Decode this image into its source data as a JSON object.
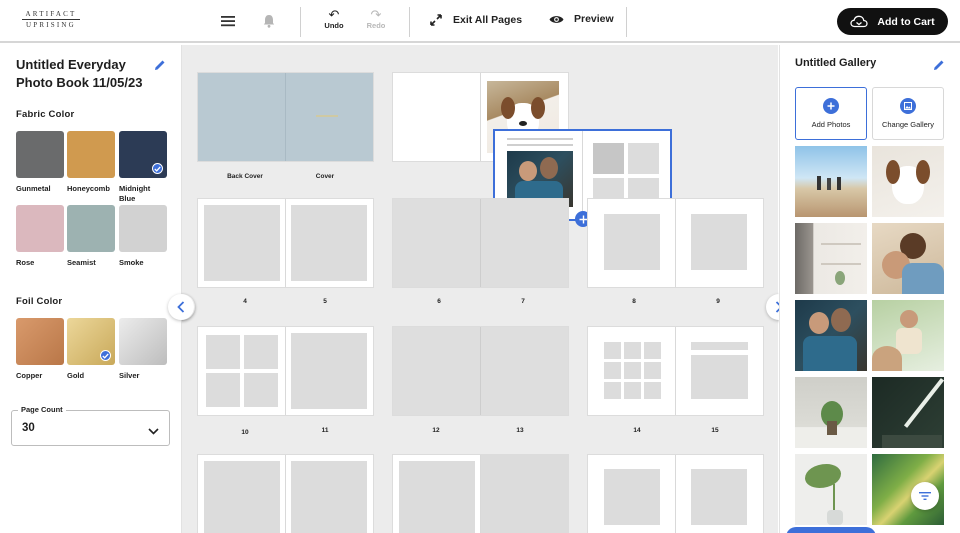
{
  "brand": {
    "line1": "ARTIFACT",
    "line2": "UPRISING"
  },
  "toolbar": {
    "undo_label": "Undo",
    "redo_label": "Redo",
    "exit_label": "Exit All Pages",
    "preview_label": "Preview",
    "cart_label": "Add to Cart",
    "icons": [
      "menu-icon",
      "bell-icon",
      "undo-icon",
      "redo-icon",
      "collapse-icon",
      "eye-icon",
      "cart-icon"
    ]
  },
  "left": {
    "title": "Untitled Everyday Photo Book 11/05/23",
    "fabric_title": "Fabric Color",
    "fabric": [
      {
        "label": "Gunmetal",
        "color": "#6a6b6c",
        "selected": false
      },
      {
        "label": "Honeycomb",
        "color": "#d09a4f",
        "selected": false
      },
      {
        "label": "Midnight Blue",
        "color": "#2c3b55",
        "selected": true
      },
      {
        "label": "Rose",
        "color": "#dbb8be",
        "selected": false
      },
      {
        "label": "Seamist",
        "color": "#9db2b1",
        "selected": false
      },
      {
        "label": "Smoke",
        "color": "#d2d2d2",
        "selected": false
      }
    ],
    "foil_title": "Foil Color",
    "foil": [
      {
        "label": "Copper",
        "color": "#c98a5e",
        "selected": false
      },
      {
        "label": "Gold",
        "color": "#dcc27a",
        "selected": true
      },
      {
        "label": "Silver",
        "color": "#d4d4d4",
        "selected": false
      }
    ],
    "page_count": {
      "label": "Page Count",
      "value": "30"
    }
  },
  "canvas": {
    "cover_labels": [
      "Back Cover",
      "Cover"
    ],
    "page_labels": [
      "4",
      "5",
      "6",
      "7",
      "8",
      "9",
      "10",
      "11",
      "12",
      "13",
      "14",
      "15"
    ],
    "cover_color": "#b9c9d2"
  },
  "gallery": {
    "title": "Untitled Gallery",
    "add_label": "Add Photos",
    "change_label": "Change Gallery",
    "photos": [
      "photo-beach-family",
      "photo-dog",
      "photo-shelf",
      "photo-mother-child",
      "photo-father-son",
      "photo-child-playing",
      "photo-plant-wall",
      "photo-dark-room",
      "photo-monstera-vase",
      "photo-palm-leaf"
    ]
  },
  "colors": {
    "accent": "#3d6fd9",
    "cart_bg": "#111111"
  }
}
